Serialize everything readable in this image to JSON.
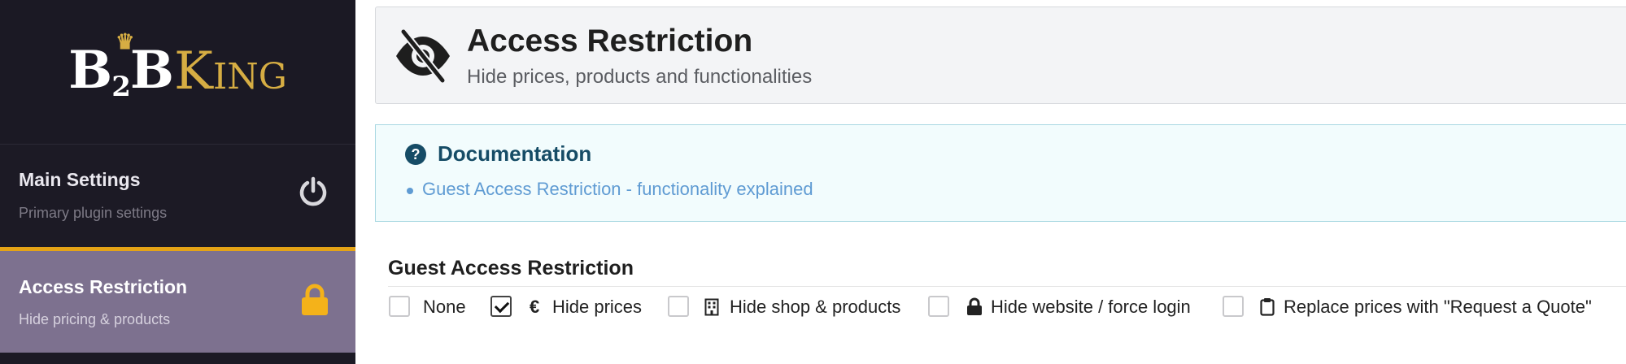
{
  "sidebar": {
    "logo": {
      "part1": "B",
      "part2": "2",
      "part3": "B",
      "part4": "K",
      "part5": "ING"
    },
    "items": [
      {
        "title": "Main Settings",
        "subtitle": "Primary plugin settings",
        "icon": "power-icon"
      },
      {
        "title": "Access Restriction",
        "subtitle": "Hide pricing & products",
        "icon": "lock-icon"
      }
    ]
  },
  "header": {
    "icon": "eye-slash-icon",
    "title": "Access Restriction",
    "subtitle": "Hide prices, products and functionalities"
  },
  "documentation": {
    "icon": "question-circle-icon",
    "title": "Documentation",
    "link": "Guest Access Restriction - functionality explained"
  },
  "guest_access": {
    "title": "Guest Access Restriction",
    "options": [
      {
        "label": "None",
        "checked": false,
        "icon": ""
      },
      {
        "label": "Hide prices",
        "checked": true,
        "icon": "euro-icon"
      },
      {
        "label": "Hide shop & products",
        "checked": false,
        "icon": "building-icon"
      },
      {
        "label": "Hide website / force login",
        "checked": false,
        "icon": "lock-icon"
      },
      {
        "label": "Replace prices with \"Request a Quote\"",
        "checked": false,
        "icon": "clipboard-icon"
      }
    ]
  },
  "colors": {
    "sidebar_bg": "#1c1a25",
    "active_bg": "#7d718f",
    "accent": "#e4a316",
    "gold": "#d6ad43",
    "doc_title": "#164c66",
    "link": "#5f9bd3"
  }
}
